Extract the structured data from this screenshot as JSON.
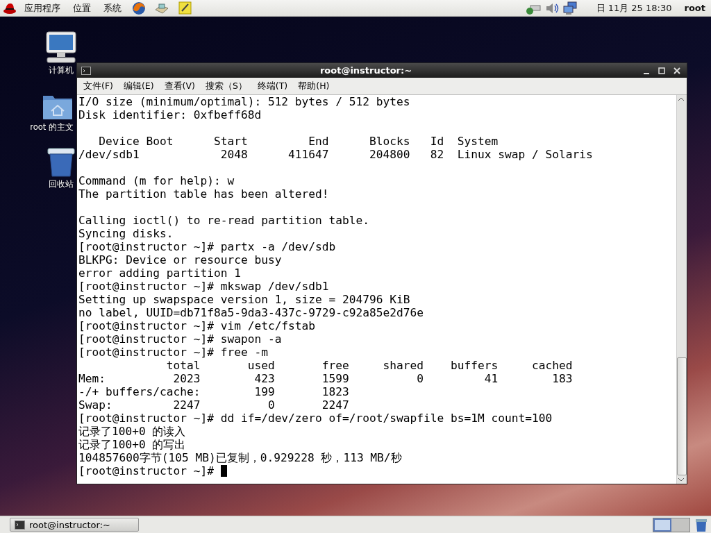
{
  "top_panel": {
    "menus": [
      "应用程序",
      "位置",
      "系统"
    ],
    "clock": "日 11月 25 18:30",
    "user": "root"
  },
  "desktop_icons": [
    {
      "kind": "computer",
      "label": "计算机"
    },
    {
      "kind": "home",
      "label": "root 的主文"
    },
    {
      "kind": "trash",
      "label": "回收站"
    }
  ],
  "window": {
    "title": "root@instructor:~",
    "menu": [
      "文件(F)",
      "编辑(E)",
      "查看(V)",
      "搜索（S）",
      "终端(T)",
      "帮助(H)"
    ],
    "terminal": {
      "blocks": [
        [
          "I/O size (minimum/optimal): 512 bytes / 512 bytes",
          "Disk identifier: 0xfbeff68d"
        ],
        [
          "   Device Boot      Start         End      Blocks   Id  System",
          "/dev/sdb1            2048      411647      204800   82  Linux swap / Solaris"
        ],
        [
          "Command (m for help): w",
          "The partition table has been altered!"
        ],
        [
          "Calling ioctl() to re-read partition table.",
          "Syncing disks.",
          "[root@instructor ~]# partx -a /dev/sdb",
          "BLKPG: Device or resource busy",
          "error adding partition 1",
          "[root@instructor ~]# mkswap /dev/sdb1",
          "Setting up swapspace version 1, size = 204796 KiB",
          "no label, UUID=db71f8a5-9da3-437c-9729-c92a85e2d76e",
          "[root@instructor ~]# vim /etc/fstab",
          "[root@instructor ~]# swapon -a",
          "[root@instructor ~]# free -m",
          "             total       used       free     shared    buffers     cached",
          "Mem:          2023        423       1599          0         41        183",
          "-/+ buffers/cache:        199       1823",
          "Swap:         2247          0       2247",
          "[root@instructor ~]# dd if=/dev/zero of=/root/swapfile bs=1M count=100",
          "记录了100+0 的读入",
          "记录了100+0 的写出",
          "104857600字节(105 MB)已复制，0.929228 秒，113 MB/秒",
          "[root@instructor ~]# "
        ]
      ],
      "cursor_visible": true
    }
  },
  "bottom_panel": {
    "tasks": [
      {
        "label": "root@instructor:~",
        "selected": false
      }
    ],
    "workspaces": [
      {
        "selected": true
      },
      {
        "selected": false
      }
    ]
  }
}
